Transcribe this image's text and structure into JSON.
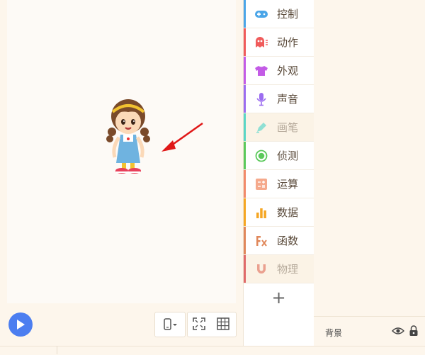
{
  "categories": [
    {
      "key": "control",
      "label": "控制",
      "color": "#4aa5e8",
      "icon": "gamepad-icon",
      "dim": false
    },
    {
      "key": "motion",
      "label": "动作",
      "color": "#f05b5b",
      "icon": "ghost-icon",
      "dim": false
    },
    {
      "key": "looks",
      "label": "外观",
      "color": "#c35be6",
      "icon": "tshirt-icon",
      "dim": false
    },
    {
      "key": "sound",
      "label": "声音",
      "color": "#9b6cf0",
      "icon": "microphone-icon",
      "dim": false
    },
    {
      "key": "pen",
      "label": "画笔",
      "color": "#5ad6c6",
      "icon": "pen-icon",
      "dim": true
    },
    {
      "key": "sensing",
      "label": "侦测",
      "color": "#5bc95b",
      "icon": "radar-icon",
      "dim": false
    },
    {
      "key": "operators",
      "label": "运算",
      "color": "#f28a6a",
      "icon": "calculator-icon",
      "dim": false
    },
    {
      "key": "data",
      "label": "数据",
      "color": "#f5a623",
      "icon": "bar-chart-icon",
      "dim": false
    },
    {
      "key": "functions",
      "label": "函数",
      "color": "#e0875a",
      "icon": "function-icon",
      "dim": false
    },
    {
      "key": "physics",
      "label": "物理",
      "color": "#e06a6a",
      "icon": "magnet-icon",
      "dim": true
    }
  ],
  "add_extension_label": "+",
  "sprite_bar": {
    "background_label": "背景"
  }
}
